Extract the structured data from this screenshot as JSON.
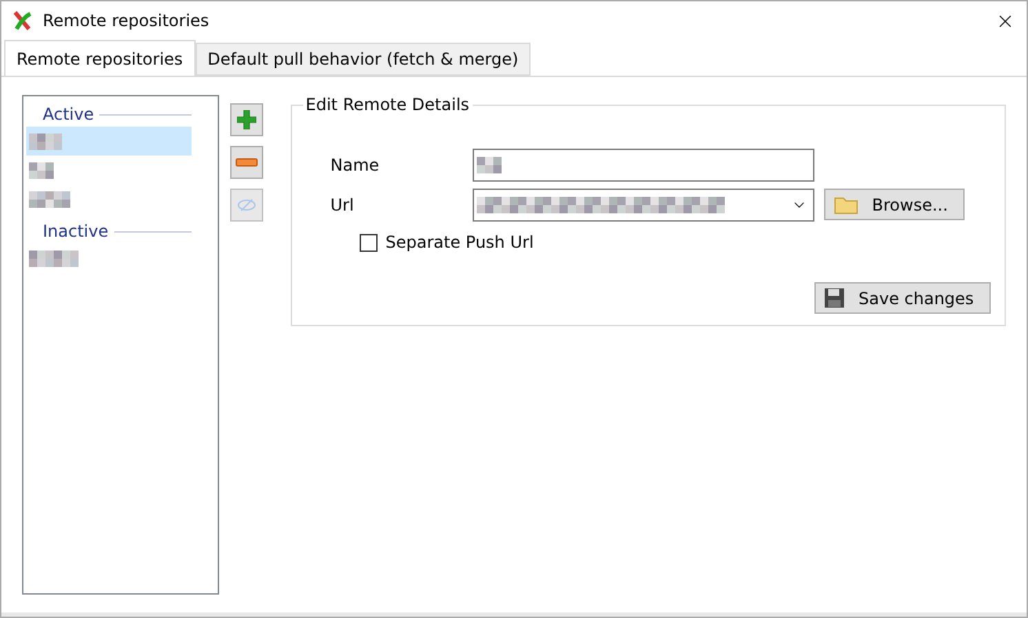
{
  "window": {
    "title": "Remote repositories"
  },
  "tabs": [
    {
      "label": "Remote repositories",
      "selected": true
    },
    {
      "label": "Default pull behavior (fetch & merge)",
      "selected": false
    }
  ],
  "remotes": {
    "groups": [
      {
        "label": "Active",
        "items": [
          {
            "selected": true
          },
          {
            "selected": false
          },
          {
            "selected": false
          }
        ]
      },
      {
        "label": "Inactive",
        "items": [
          {
            "selected": false
          }
        ]
      }
    ]
  },
  "side_buttons": [
    {
      "kind": "add",
      "disabled": false
    },
    {
      "kind": "remove",
      "disabled": false
    },
    {
      "kind": "toggle",
      "disabled": true
    }
  ],
  "details": {
    "title": "Edit Remote Details",
    "name_label": "Name",
    "url_label": "Url",
    "browse": "Browse...",
    "separate_push": {
      "label": "Separate Push Url",
      "checked": false
    },
    "save": "Save changes"
  }
}
